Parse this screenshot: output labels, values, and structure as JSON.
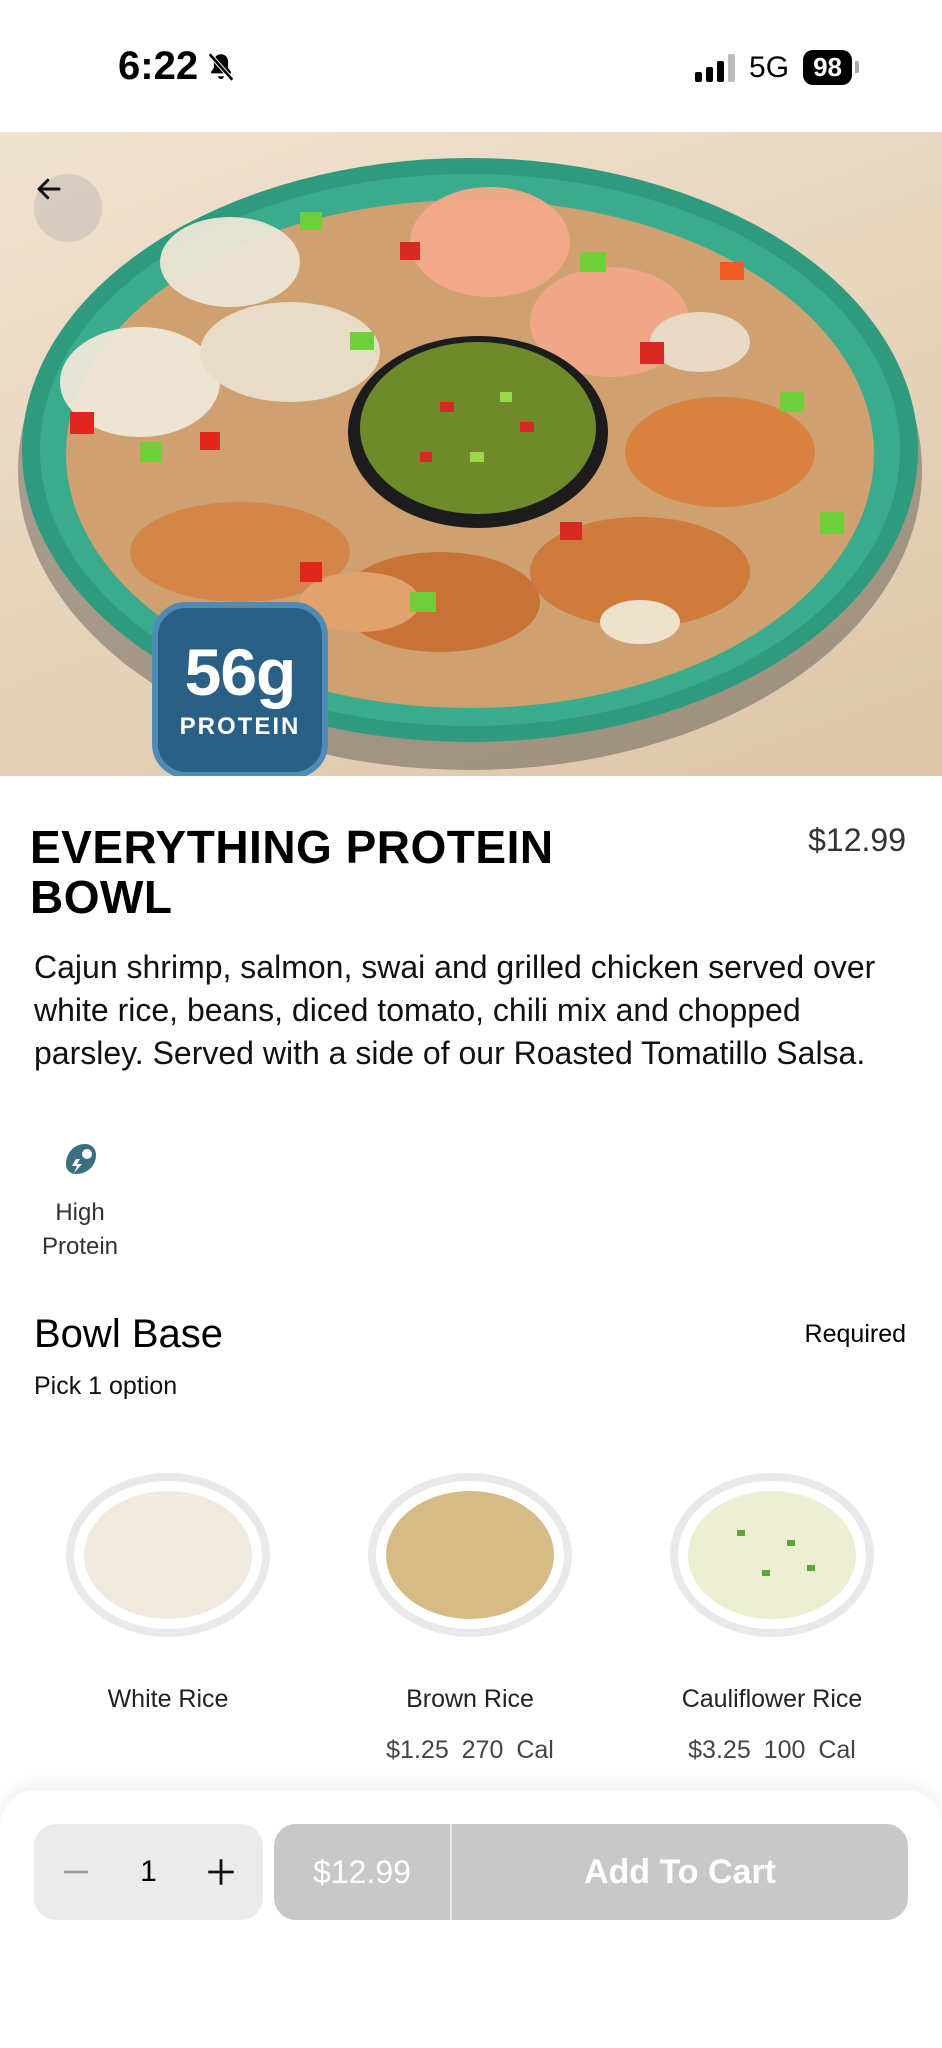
{
  "status_bar": {
    "time": "6:22",
    "network": "5G",
    "battery": "98"
  },
  "hero": {
    "badge_value": "56g",
    "badge_label": "PROTEIN"
  },
  "item": {
    "title": "EVERYTHING PROTEIN BOWL",
    "price": "$12.99",
    "description": "Cajun shrimp, salmon, swai and grilled chicken served over white rice, beans, diced tomato, chili mix and chopped parsley. Served with a side of our Roasted Tomatillo Salsa."
  },
  "dietary": {
    "label": "High Protein",
    "icon": "protein-leaf-icon"
  },
  "section": {
    "title": "Bowl Base",
    "required": "Required",
    "subtitle": "Pick 1 option"
  },
  "options": [
    {
      "name": "White Rice",
      "price": "",
      "calories": "",
      "color": "#f4eee3"
    },
    {
      "name": "Brown Rice",
      "price": "$1.25",
      "calories": "270 Cal",
      "color": "#d8bd8a"
    },
    {
      "name": "Cauliflower Rice",
      "price": "$3.25",
      "calories": "100 Cal",
      "color": "#eef0d8"
    }
  ],
  "cart": {
    "quantity": "1",
    "price": "$12.99",
    "label": "Add To Cart"
  },
  "colors": {
    "badge_bg": "#2a5f86",
    "button_disabled": "#c8c8c8",
    "bowl_rim": "#2f9a7e"
  }
}
